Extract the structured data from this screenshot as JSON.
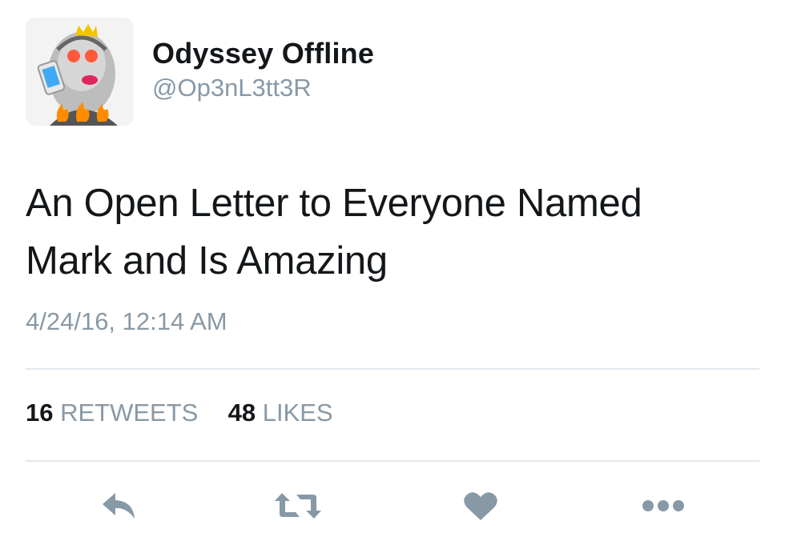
{
  "tweet": {
    "display_name": "Odyssey Offline",
    "handle": "@Op3nL3tt3R",
    "text_line1": "An Open Letter to Everyone Named",
    "text_line2": "Mark and Is Amazing",
    "timestamp": "4/24/16, 12:14 AM",
    "retweets_count": "16",
    "retweets_label": "RETWEETS",
    "likes_count": "48",
    "likes_label": "LIKES"
  },
  "actions": {
    "reply_icon": "reply-icon",
    "retweet_icon": "retweet-icon",
    "like_icon": "heart-icon",
    "more_icon": "more-dots-icon"
  },
  "colors": {
    "text": "#14171a",
    "muted": "#8899a6",
    "divider": "#e1e8ed"
  }
}
